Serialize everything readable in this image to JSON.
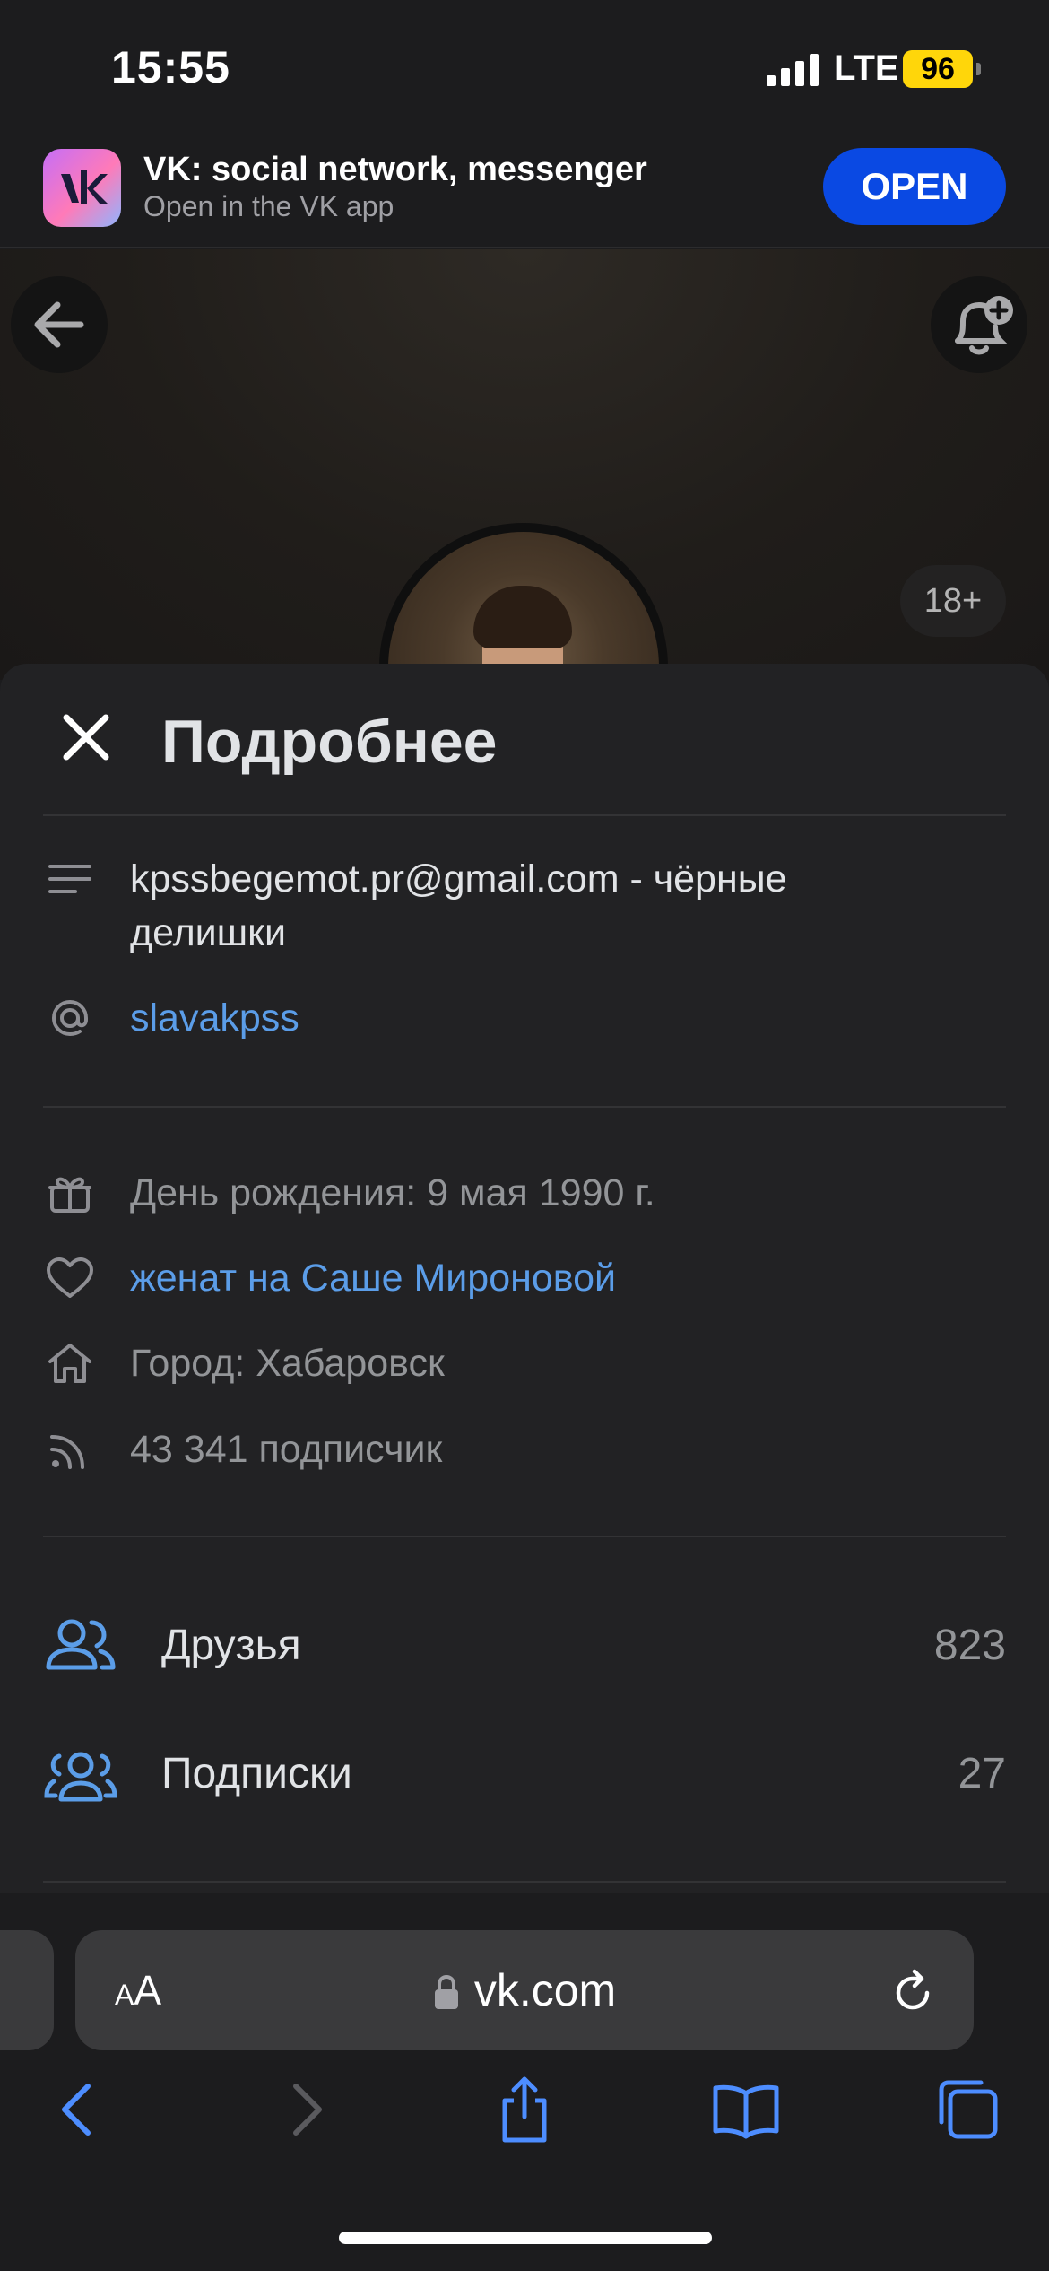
{
  "status_bar": {
    "time": "15:55",
    "network": "LTE",
    "battery": "96"
  },
  "banner": {
    "title": "VK: social network, messenger",
    "subtitle": "Open in the VK app",
    "open_label": "OPEN"
  },
  "cover": {
    "age_badge": "18+"
  },
  "sheet": {
    "title": "Подробнее",
    "status_line1": "kpssbegemot.pr@gmail.com - чёрные",
    "status_line2": "делишки",
    "nickname": "slavakpss",
    "birthday": "День рождения: 9 мая 1990 г.",
    "relationship": "женат на Саше Мироновой",
    "city": "Город: Хабаровск",
    "followers": "43 341 подписчик",
    "menu": [
      {
        "label": "Друзья",
        "count": "823"
      },
      {
        "label": "Подписки",
        "count": "27"
      }
    ]
  },
  "browser": {
    "text_size_label_small": "A",
    "text_size_label_large": "A",
    "url": "vk.com"
  },
  "colors": {
    "accent": "#5b9de8",
    "open_button": "#0a49e3",
    "battery": "#ffd60a",
    "background": "#1c1c1e"
  }
}
